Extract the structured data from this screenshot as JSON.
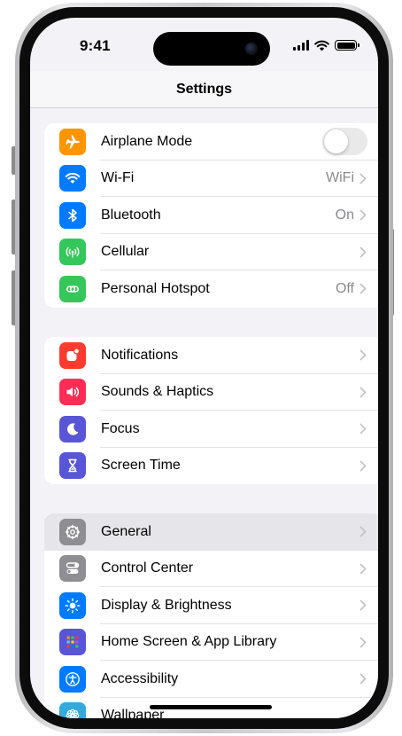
{
  "status_bar": {
    "time": "9:41"
  },
  "nav": {
    "title": "Settings"
  },
  "groups": [
    {
      "rows": [
        {
          "label": "Airplane Mode",
          "icon": "airplane-icon",
          "color": "#ff9500",
          "accessory": "toggle",
          "toggle_on": false
        },
        {
          "label": "Wi-Fi",
          "value": "WiFi",
          "icon": "wifi-icon",
          "color": "#007aff",
          "accessory": "chevron"
        },
        {
          "label": "Bluetooth",
          "value": "On",
          "icon": "bluetooth-icon",
          "color": "#007aff",
          "accessory": "chevron"
        },
        {
          "label": "Cellular",
          "icon": "cellular-icon",
          "color": "#34c759",
          "accessory": "chevron"
        },
        {
          "label": "Personal Hotspot",
          "value": "Off",
          "icon": "hotspot-icon",
          "color": "#34c759",
          "accessory": "chevron"
        }
      ]
    },
    {
      "rows": [
        {
          "label": "Notifications",
          "icon": "notifications-icon",
          "color": "#ff3b30",
          "accessory": "chevron"
        },
        {
          "label": "Sounds & Haptics",
          "icon": "speaker-icon",
          "color": "#ff2d55",
          "accessory": "chevron"
        },
        {
          "label": "Focus",
          "icon": "moon-icon",
          "color": "#5856d6",
          "accessory": "chevron"
        },
        {
          "label": "Screen Time",
          "icon": "hourglass-icon",
          "color": "#5856d6",
          "accessory": "chevron"
        }
      ]
    },
    {
      "rows": [
        {
          "label": "General",
          "icon": "gear-icon",
          "color": "#8e8e93",
          "accessory": "chevron",
          "highlighted": true
        },
        {
          "label": "Control Center",
          "icon": "toggles-icon",
          "color": "#8e8e93",
          "accessory": "chevron"
        },
        {
          "label": "Display & Brightness",
          "icon": "sun-icon",
          "color": "#007aff",
          "accessory": "chevron"
        },
        {
          "label": "Home Screen & App Library",
          "icon": "home-grid-icon",
          "color": "#5856d6",
          "accessory": "chevron"
        },
        {
          "label": "Accessibility",
          "icon": "accessibility-icon",
          "color": "#007aff",
          "accessory": "chevron"
        },
        {
          "label": "Wallpaper",
          "icon": "flower-icon",
          "color": "#34aadc",
          "accessory": "chevron"
        }
      ]
    }
  ]
}
